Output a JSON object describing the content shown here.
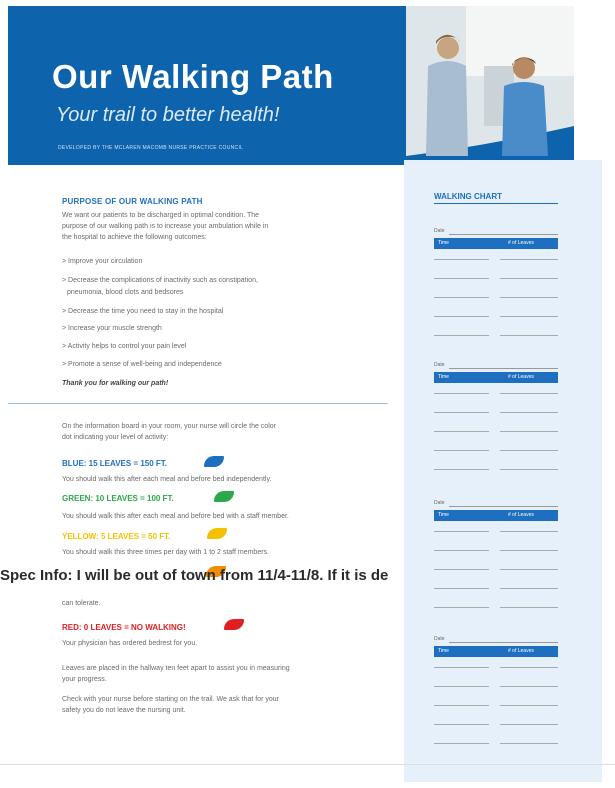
{
  "header": {
    "title": "Our Walking Path",
    "subtitle": "Your trail to better health!",
    "developed_by": "DEVELOPED BY THE MCLAREN MACOMB NURSE PRACTICE COUNCIL"
  },
  "purpose": {
    "heading": "PURPOSE OF OUR WALKING PATH",
    "intro": [
      "We want our patients to be discharged in optimal condition. The",
      "purpose of our walking path is to increase your ambulation while in",
      "the hospital to achieve the following outcomes:"
    ],
    "bullets": [
      "> Improve your circulation",
      "> Decrease the complications of inactivity such as constipation,",
      "pneumonia, blood clots and bedsores",
      "> Decrease the time you need to stay in the hospital",
      "> Increase your muscle strength",
      "> Activity helps to control your pain level",
      "> Promote a sense of well-being and independence"
    ],
    "thanks": "Thank you for walking our path!"
  },
  "levels": {
    "intro": [
      "On the information board in your room, your nurse will circle the color",
      "dot indicating your level of activity:"
    ],
    "items": [
      {
        "heading": "BLUE: 15 LEAVES = 150 FT.",
        "color": "#1f6fc0",
        "desc": "You should walk this after each meal and before bed independently."
      },
      {
        "heading": "GREEN: 10 LEAVES = 100 FT.",
        "color": "#2aa84a",
        "desc": "You should walk this after each meal and before bed with a staff member."
      },
      {
        "heading": "YELLOW: 5 LEAVES = 50 FT.",
        "color": "#f2c200",
        "desc": "You should walk this three times per day with 1 to 2 staff members."
      },
      {
        "heading": "RED: 0 LEAVES = NO WALKING!",
        "color": "#e02020",
        "desc": "Your physician has ordered bedrest for you."
      }
    ],
    "orange_tail": "can tolerate.",
    "orange_color": "#f28c00",
    "leaves_note": [
      "Leaves are placed in the hallway ten feet apart to assist you in measuring",
      "your progress."
    ],
    "check_note": [
      "Check with your nurse before starting on the trail. We ask that for your",
      "safety you do not leave the nursing unit."
    ]
  },
  "chart": {
    "title": "WALKING CHART",
    "date_label": "Date",
    "col_time": "Time",
    "col_leaves": "# of Leaves"
  },
  "overlay_text": "Spec Info: I will be out of town from 11/4-11/8. If it is de",
  "colors": {
    "brand_blue": "#0e63ad",
    "panel": "#e6f0fb"
  }
}
